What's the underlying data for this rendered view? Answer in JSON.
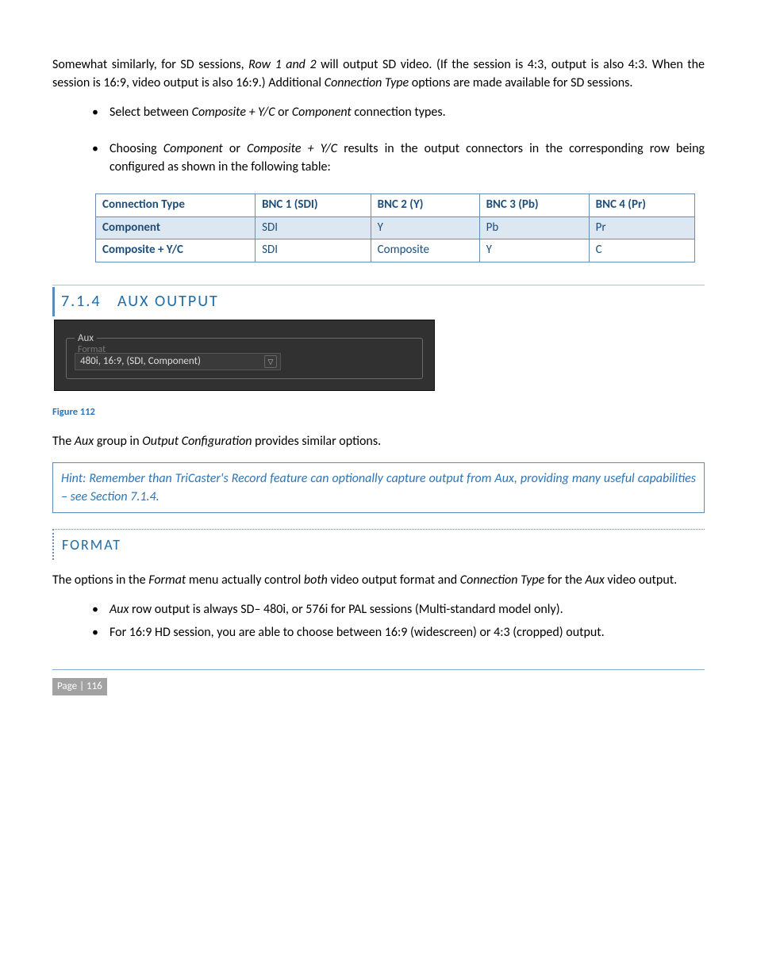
{
  "intro": {
    "p1_pre": "Somewhat similarly, for SD sessions, ",
    "p1_em": "Row 1 and 2",
    "p1_mid": " will output SD video.  (If the session is 4:3, output is also 4:3.  When the session is 16:9, video output is also 16:9.)  Additional ",
    "p1_em2": "Connection Type",
    "p1_post": " options are made available for SD sessions."
  },
  "bullets1": {
    "b1_pre": "Select between ",
    "b1_em": "Composite + Y/C",
    "b1_mid": " or ",
    "b1_em2": "Component",
    "b1_post": " connection types.",
    "b2_pre": "Choosing ",
    "b2_em": "Component",
    "b2_mid": " or ",
    "b2_em2": "Composite + Y/C",
    "b2_post": " results in the output connectors in the corresponding row being configured as shown in the following table:"
  },
  "table": {
    "h1": "Connection Type",
    "h2": "BNC 1 (SDI)",
    "h3": "BNC 2 (Y)",
    "h4": "BNC 3 (Pb)",
    "h5": "BNC 4 (Pr)",
    "r1c1": "Component",
    "r1c2": "SDI",
    "r1c3": "Y",
    "r1c4": "Pb",
    "r1c5": "Pr",
    "r2c1": "Composite + Y/C",
    "r2c2": "SDI",
    "r2c3": "Composite",
    "r2c4": "Y",
    "r2c5": "C"
  },
  "section": {
    "num": "7.1.4",
    "title": "AUX OUTPUT"
  },
  "aux": {
    "legend": "Aux",
    "format_label": "Format",
    "value": "480i, 16:9, (SDI, Component)"
  },
  "figure": "Figure 112",
  "after_panel": {
    "pre": "The ",
    "em1": "Aux",
    "mid1": " group in ",
    "em2": "Output Configuration",
    "post": " provides similar options."
  },
  "hint": "Hint: Remember than TriCaster's Record feature can optionally capture output from Aux, providing many useful capabilities – see Section 7.1.4.",
  "format_hdr": "FORMAT",
  "format_para": {
    "pre": "The options in the ",
    "em1": "Format",
    "mid1": " menu actually control ",
    "em2": "both",
    "mid2": " video output format and ",
    "em3": "Connection Type",
    "mid3": " for the ",
    "em4": "Aux",
    "post": " video output."
  },
  "bullets2": {
    "b1_em": "Aux",
    "b1_post": " row output is always SD– 480i, or 576i for PAL sessions (Multi-standard model only).",
    "b2": "For 16:9 HD session, you are able to choose between 16:9 (widescreen) or 4:3 (cropped) output."
  },
  "footer": "Page | 116"
}
